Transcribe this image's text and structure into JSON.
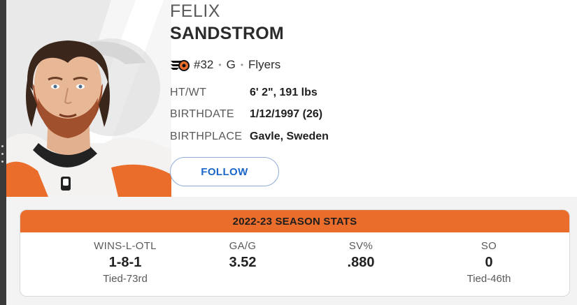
{
  "player": {
    "first_name": "FELIX",
    "last_name": "SANDSTROM",
    "number": "#32",
    "position": "G",
    "team": "Flyers",
    "team_logo_icon": "flyers-logo-icon",
    "photo": "player-headshot"
  },
  "separator": "•",
  "bio": [
    {
      "label": "HT/WT",
      "value": "6' 2\", 191 lbs"
    },
    {
      "label": "BIRTHDATE",
      "value": "1/12/1997 (26)"
    },
    {
      "label": "BIRTHPLACE",
      "value": "Gavle, Sweden"
    }
  ],
  "follow_label": "FOLLOW",
  "season_stats": {
    "title": "2022-23 SEASON STATS",
    "stats": [
      {
        "label": "WINS-L-OTL",
        "value": "1-8-1",
        "rank": "Tied-73rd"
      },
      {
        "label": "GA/G",
        "value": "3.52",
        "rank": ""
      },
      {
        "label": "SV%",
        "value": ".880",
        "rank": ""
      },
      {
        "label": "SO",
        "value": "0",
        "rank": "Tied-46th"
      }
    ]
  },
  "colors": {
    "accent": "#ea6d2b",
    "follow_text": "#1b66c9",
    "follow_border": "#8eaed6"
  }
}
